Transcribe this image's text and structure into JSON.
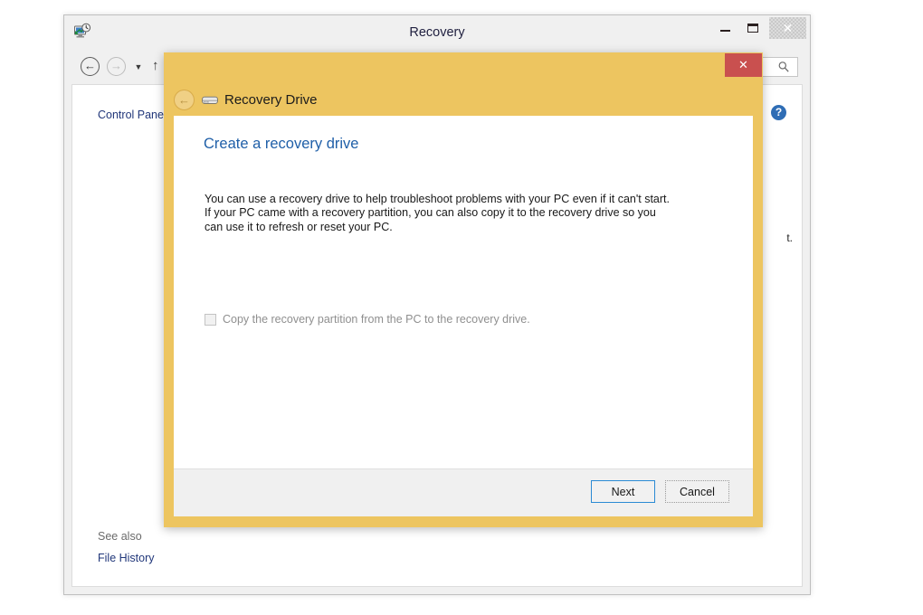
{
  "colors": {
    "dialog_gold": "#edc560",
    "dialog_close_red": "#c9504f",
    "heading_blue": "#1f5fa8",
    "link_blue": "#21377a",
    "focus_blue": "#2a8ad4",
    "help_blue": "#2f6db5",
    "window_chrome": "#f0f0f0"
  },
  "explorer": {
    "title": "Recovery",
    "icon": "recovery-computer-clock-icon",
    "caption_buttons": {
      "minimize_label": "–",
      "maximize_label": "❑",
      "close_label": "✕"
    },
    "toolbar": {
      "back_label": "←",
      "forward_label": "→",
      "recent_label": "▼",
      "up_label": "↑",
      "address_value": "",
      "address_placeholder": "",
      "search_placeholder": "",
      "search_value": "",
      "search_icon": "magnifier-icon"
    },
    "content": {
      "breadcrumb": "Control Pane",
      "help_label": "?",
      "right_text_fragment": "t.",
      "see_also_label": "See also",
      "file_history_link": "File History"
    }
  },
  "recovery_dialog": {
    "title": "Recovery Drive",
    "title_icon": "external-drive-icon",
    "back_label": "←",
    "close_label": "✕",
    "heading": "Create a recovery drive",
    "paragraph": "You can use a recovery drive to help troubleshoot problems with your PC even if it can't start. If your PC came with a recovery partition, you can also copy it to the recovery drive so you can use it to refresh or reset your PC.",
    "checkbox": {
      "label": "Copy the recovery partition from the PC to the recovery drive.",
      "checked": false,
      "enabled": false
    },
    "buttons": {
      "next_label": "Next",
      "cancel_label": "Cancel"
    }
  }
}
